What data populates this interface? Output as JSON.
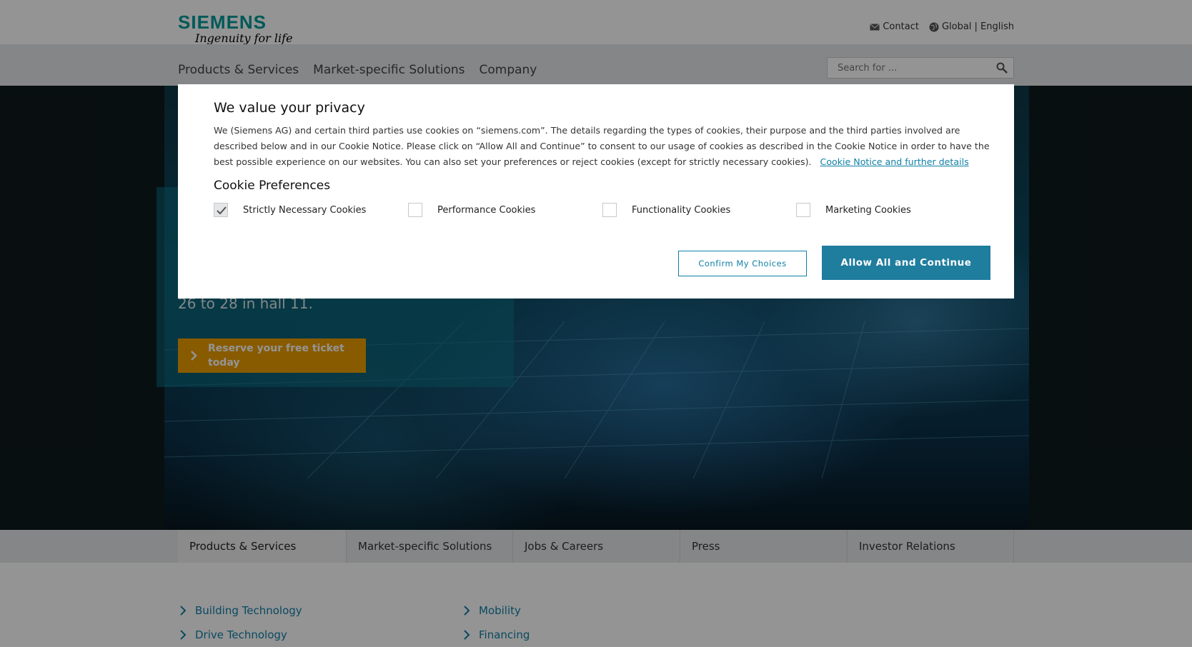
{
  "brand": {
    "name": "SIEMENS",
    "tagline": "Ingenuity for life"
  },
  "top_links": {
    "contact": "Contact",
    "locale": "Global | English"
  },
  "main_nav": [
    "Products & Services",
    "Market-specific Solutions",
    "Company"
  ],
  "search": {
    "placeholder": "Search for ..."
  },
  "hero": {
    "text": "26 to 28 in hall 11.",
    "cta": "Reserve your free ticket today"
  },
  "bottom_tabs": [
    "Products & Services",
    "Market-specific Solutions",
    "Jobs & Careers",
    "Press",
    "Investor Relations"
  ],
  "bottom_links": {
    "col1": [
      "Building Technology",
      "Drive Technology"
    ],
    "col2": [
      "Mobility",
      "Financing"
    ]
  },
  "cookie_modal": {
    "title": "We value your privacy",
    "body": "We (Siemens AG) and certain third parties use cookies on “siemens.com”. The details regarding the types of cookies, their purpose and the third parties involved are described below and in our Cookie Notice. Please click on “Allow All and Continue” to consent to our usage of cookies as described in the Cookie Notice in order to have the best possible experience on our websites. You can also set your preferences or reject cookies (except for strictly necessary cookies).",
    "notice_link": "Cookie Notice and further details",
    "preferences_title": "Cookie Preferences",
    "preferences": [
      {
        "label": "Strictly Necessary Cookies",
        "checked": true
      },
      {
        "label": "Performance Cookies",
        "checked": false
      },
      {
        "label": "Functionality Cookies",
        "checked": false
      },
      {
        "label": "Marketing Cookies",
        "checked": false
      }
    ],
    "confirm_button": "Confirm My Choices",
    "allow_button": "Allow All and Continue"
  },
  "colors": {
    "brand": "#009999",
    "link": "#0f7fa6",
    "primary_button": "#1f7d9e",
    "cta": "#eb9d00"
  }
}
